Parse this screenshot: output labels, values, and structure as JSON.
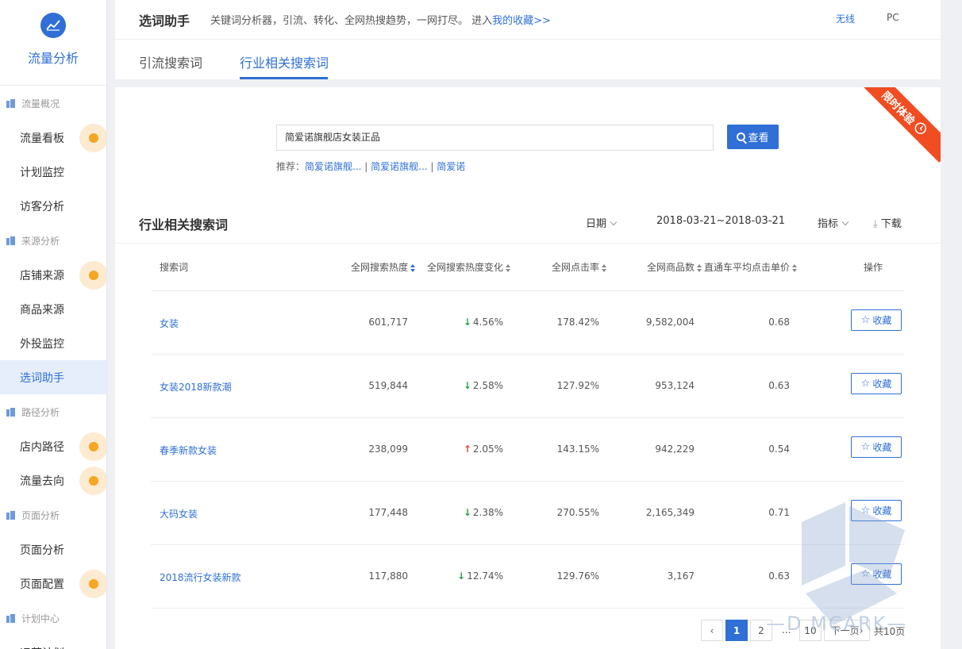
{
  "sidebar": {
    "brand": "流量分析",
    "items": [
      {
        "type": "section",
        "label": "流量概况"
      },
      {
        "type": "nav",
        "label": "流量看板",
        "dot": true
      },
      {
        "type": "nav",
        "label": "计划监控",
        "dot": false
      },
      {
        "type": "nav",
        "label": "访客分析",
        "dot": false
      },
      {
        "type": "section",
        "label": "来源分析"
      },
      {
        "type": "nav",
        "label": "店铺来源",
        "dot": true
      },
      {
        "type": "nav",
        "label": "商品来源",
        "dot": false
      },
      {
        "type": "nav",
        "label": "外投监控",
        "dot": false
      },
      {
        "type": "nav",
        "label": "选词助手",
        "dot": false,
        "active": true
      },
      {
        "type": "section",
        "label": "路径分析"
      },
      {
        "type": "nav",
        "label": "店内路径",
        "dot": true
      },
      {
        "type": "nav",
        "label": "流量去向",
        "dot": true
      },
      {
        "type": "section",
        "label": "页面分析"
      },
      {
        "type": "nav",
        "label": "页面分析",
        "dot": false
      },
      {
        "type": "nav",
        "label": "页面配置",
        "dot": true
      },
      {
        "type": "section",
        "label": "计划中心"
      },
      {
        "type": "nav",
        "label": "运营计划",
        "dot": false
      }
    ]
  },
  "header": {
    "title": "选词助手",
    "description": "关键词分析器，引流、转化、全网热搜趋势，一网打尽。 进入",
    "favorites_link": "我的收藏>>",
    "wireless": "无线",
    "pc": "PC"
  },
  "tabs": {
    "tab1": "引流搜索词",
    "tab2": "行业相关搜索词"
  },
  "ribbon": "限时体验",
  "search": {
    "value": "简爱诺旗舰店女装正品",
    "button": "查看",
    "rec_label": "推荐：",
    "rec1": "简爱诺旗舰...",
    "rec2": "简爱诺旗舰...",
    "rec3": "简爱诺",
    "sep": " | "
  },
  "table_section": {
    "title": "行业相关搜索词",
    "date_label": "日期",
    "date_range": "2018-03-21~2018-03-21",
    "metrics_label": "指标",
    "download_label": "下载"
  },
  "table": {
    "headers": [
      "搜索词",
      "全网搜索热度",
      "全网搜索热度变化",
      "全网点击率",
      "全网商品数",
      "直通车平均点击单价",
      "操作"
    ],
    "action_label": "收藏",
    "rows": [
      {
        "keyword": "女装",
        "heat": "601,717",
        "change": "4.56%",
        "dir": "down",
        "ctr": "178.42%",
        "items": "9,582,004",
        "cpc": "0.68"
      },
      {
        "keyword": "女装2018新款潮",
        "heat": "519,844",
        "change": "2.58%",
        "dir": "down",
        "ctr": "127.92%",
        "items": "953,124",
        "cpc": "0.63"
      },
      {
        "keyword": "春季新款女装",
        "heat": "238,099",
        "change": "2.05%",
        "dir": "up",
        "ctr": "143.15%",
        "items": "942,229",
        "cpc": "0.54"
      },
      {
        "keyword": "大码女装",
        "heat": "177,448",
        "change": "2.38%",
        "dir": "down",
        "ctr": "270.55%",
        "items": "2,165,349",
        "cpc": "0.71"
      },
      {
        "keyword": "2018流行女装新款",
        "heat": "117,880",
        "change": "12.74%",
        "dir": "down",
        "ctr": "129.76%",
        "items": "3,167",
        "cpc": "0.63"
      }
    ]
  },
  "pagination": {
    "prev": "‹",
    "p1": "1",
    "p2": "2",
    "ellipsis": "...",
    "p10": "10",
    "next": "下一页",
    "total": "共10页"
  },
  "watermark": "—D.MCARK—"
}
